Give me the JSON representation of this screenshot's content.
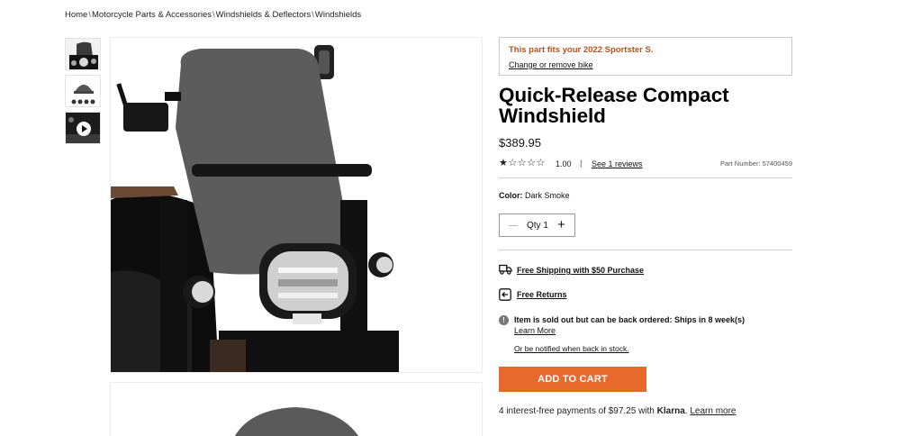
{
  "breadcrumb": [
    {
      "label": "Home"
    },
    {
      "label": "Motorcycle Parts & Accessories"
    },
    {
      "label": "Windshields & Deflectors"
    },
    {
      "label": "Windshields"
    }
  ],
  "breadcrumb_separator": "\\",
  "thumbnails": [
    {
      "kind": "image",
      "icon": "windshield-bike-thumbnail"
    },
    {
      "kind": "image",
      "icon": "windshield-hardware-thumbnail"
    },
    {
      "kind": "video",
      "icon": "play-icon"
    }
  ],
  "fitment": {
    "text": "This part fits your 2022 Sportster S.",
    "link": "Change or remove bike",
    "color": "#b3541e"
  },
  "product": {
    "title": "Quick-Release Compact Windshield",
    "price": "$389.95",
    "rating_value": "1.00",
    "rating_stars_filled": 1,
    "rating_stars_total": 5,
    "rating_separator": "|",
    "reviews_link": "See 1 reviews",
    "part_number": "Part Number: 57400459",
    "color_label": "Color:",
    "color_value": "Dark Smoke"
  },
  "quantity": {
    "label": "Qty",
    "value": "1",
    "minus_icon": "minus-icon",
    "plus_icon": "plus-icon"
  },
  "shipping": {
    "free_shipping": "Free Shipping with $50 Purchase",
    "free_returns": "Free Returns"
  },
  "stock": {
    "message": "Item is sold out but can be back ordered: Ships in 8 week(s)",
    "learn_more": "Learn More",
    "notify": "Or be notified when back in stock."
  },
  "cart": {
    "button": "ADD TO CART",
    "color": "#e8692c"
  },
  "klarna": {
    "prefix": "4 interest-free payments of $97.25 with",
    "brand": "Klarna",
    "suffix": ".",
    "link": "Learn more"
  }
}
